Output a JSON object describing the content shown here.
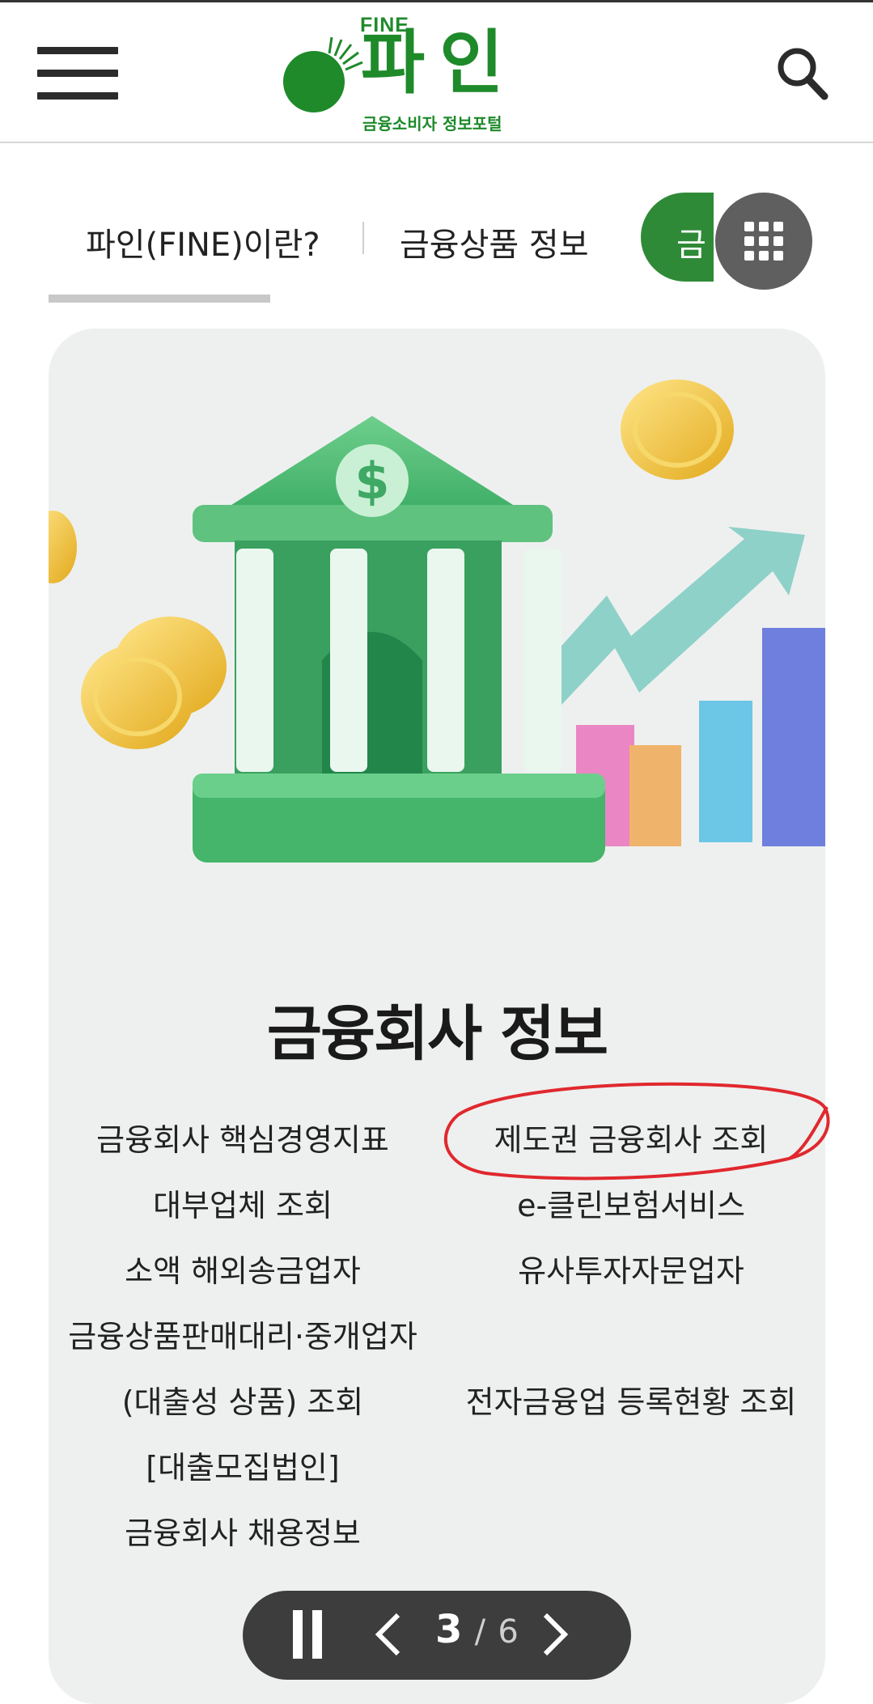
{
  "header": {
    "logo_fine": "FINE",
    "logo_main": "파인",
    "logo_sub": "금융소비자 정보포털",
    "menu_icon": "hamburger-menu-icon",
    "search_icon": "search-icon"
  },
  "tabs": {
    "items": [
      {
        "label": "파인(FINE)이란?",
        "active": true
      },
      {
        "label": "금융상품 정보",
        "active": false
      },
      {
        "label": "금",
        "active": false
      }
    ],
    "grid_icon": "apps-grid-icon"
  },
  "card": {
    "title": "금융회사 정보",
    "links_left": {
      "core_indicators": "금융회사 핵심경영지표",
      "lender_lookup": "대부업체 조회",
      "remittance": "소액 해외송금업자",
      "agent_line1": "금융상품판매대리·중개업자",
      "agent_line2": "(대출성 상품) 조회",
      "agent_line3": "[대출모집법인]",
      "recruitment": "금융회사 채용정보"
    },
    "links_right": {
      "institutional_lookup": "제도권 금융회사 조회",
      "eclean": "e-클린보험서비스",
      "advisory": "유사투자자문업자",
      "e_finance": "전자금융업 등록현황 조회"
    }
  },
  "slider": {
    "current": "3",
    "separator": "/",
    "total": "6"
  },
  "colors": {
    "brand_green": "#1e8a2a",
    "highlight_red": "#e0282e",
    "card_bg": "#eef0ef"
  }
}
